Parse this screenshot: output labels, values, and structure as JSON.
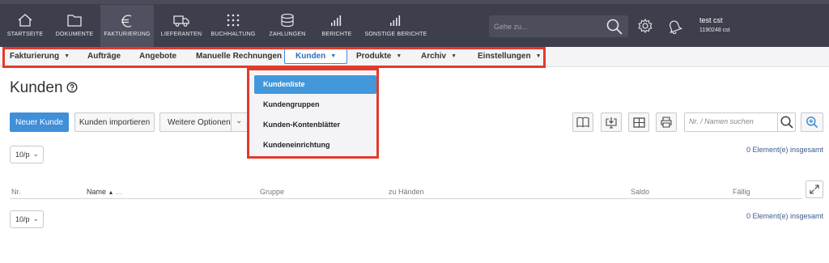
{
  "topnav": {
    "items": [
      {
        "label": "STARTSEITE",
        "icon": "home-icon"
      },
      {
        "label": "DOKUMENTE",
        "icon": "folder-icon"
      },
      {
        "label": "FAKTURIERUNG",
        "icon": "euro-icon",
        "active": true
      },
      {
        "label": "LIEFERANTEN",
        "icon": "truck-icon"
      },
      {
        "label": "BUCHHALTUNG",
        "icon": "grid-dots-icon"
      },
      {
        "label": "ZAHLUNGEN",
        "icon": "coins-icon"
      },
      {
        "label": "BERICHTE",
        "icon": "bar-chart-icon"
      },
      {
        "label": "SONSTIGE BERICHTE",
        "icon": "bar-chart-icon"
      }
    ],
    "search_placeholder": "Gehe zu...",
    "user_name": "test cst",
    "user_id": "1190248 cst"
  },
  "submenu": {
    "items": [
      {
        "label": "Fakturierung",
        "has_arrow": true
      },
      {
        "label": "Aufträge",
        "has_arrow": false
      },
      {
        "label": "Angebote",
        "has_arrow": false
      },
      {
        "label": "Manuelle Rechnungen",
        "has_arrow": false
      },
      {
        "label": "Kunden",
        "has_arrow": true,
        "active": true
      },
      {
        "label": "Produkte",
        "has_arrow": true
      },
      {
        "label": "Archiv",
        "has_arrow": true
      },
      {
        "label": "Einstellungen",
        "has_arrow": true
      }
    ]
  },
  "dropdown": {
    "items": [
      {
        "label": "Kundenliste",
        "active": true
      },
      {
        "label": "Kundengruppen"
      },
      {
        "label": "Kunden-Kontenblätter"
      },
      {
        "label": "Kundeneinrichtung"
      }
    ]
  },
  "page": {
    "title": "Kunden",
    "new_button": "Neuer Kunde",
    "import_button": "Kunden importieren",
    "more_options": "Weitere Optionen",
    "search_placeholder": "Nr. / Namen suchen"
  },
  "table": {
    "per_page": "10/p",
    "total_text": "0 Element(e) insgesamt",
    "columns": [
      "Nr.",
      "Name",
      "...",
      "Gruppe",
      "zu Händen",
      "Saldo",
      "Fällig"
    ],
    "sort_indicator": "▲"
  },
  "colors": {
    "topbar": "#3d3f4c",
    "accent": "#3f8fd9",
    "highlight": "#e33a2c"
  }
}
